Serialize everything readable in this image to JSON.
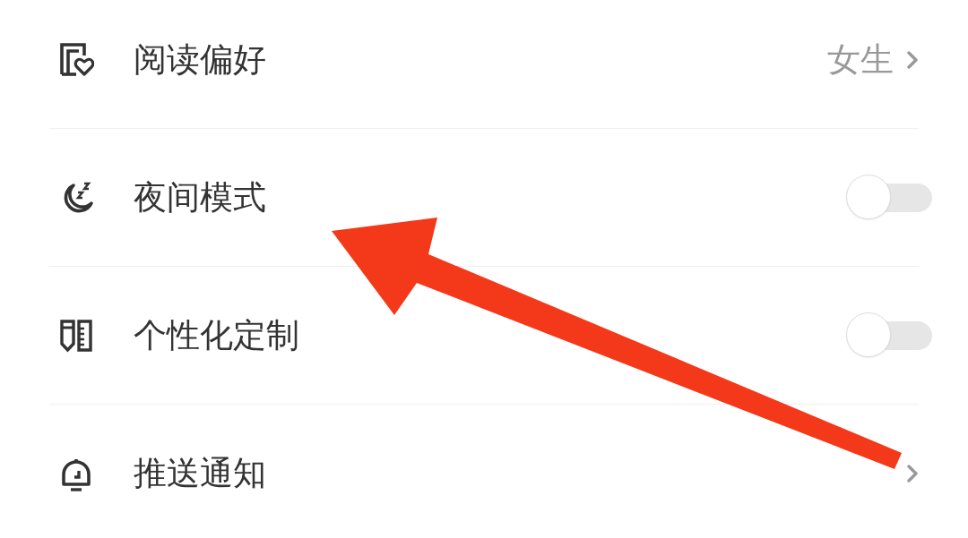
{
  "settings": [
    {
      "kind": "link",
      "label": "阅读偏好",
      "value": "女生"
    },
    {
      "kind": "toggle",
      "label": "夜间模式",
      "on": false
    },
    {
      "kind": "toggle",
      "label": "个性化定制",
      "on": false
    },
    {
      "kind": "link",
      "label": "推送通知"
    }
  ]
}
